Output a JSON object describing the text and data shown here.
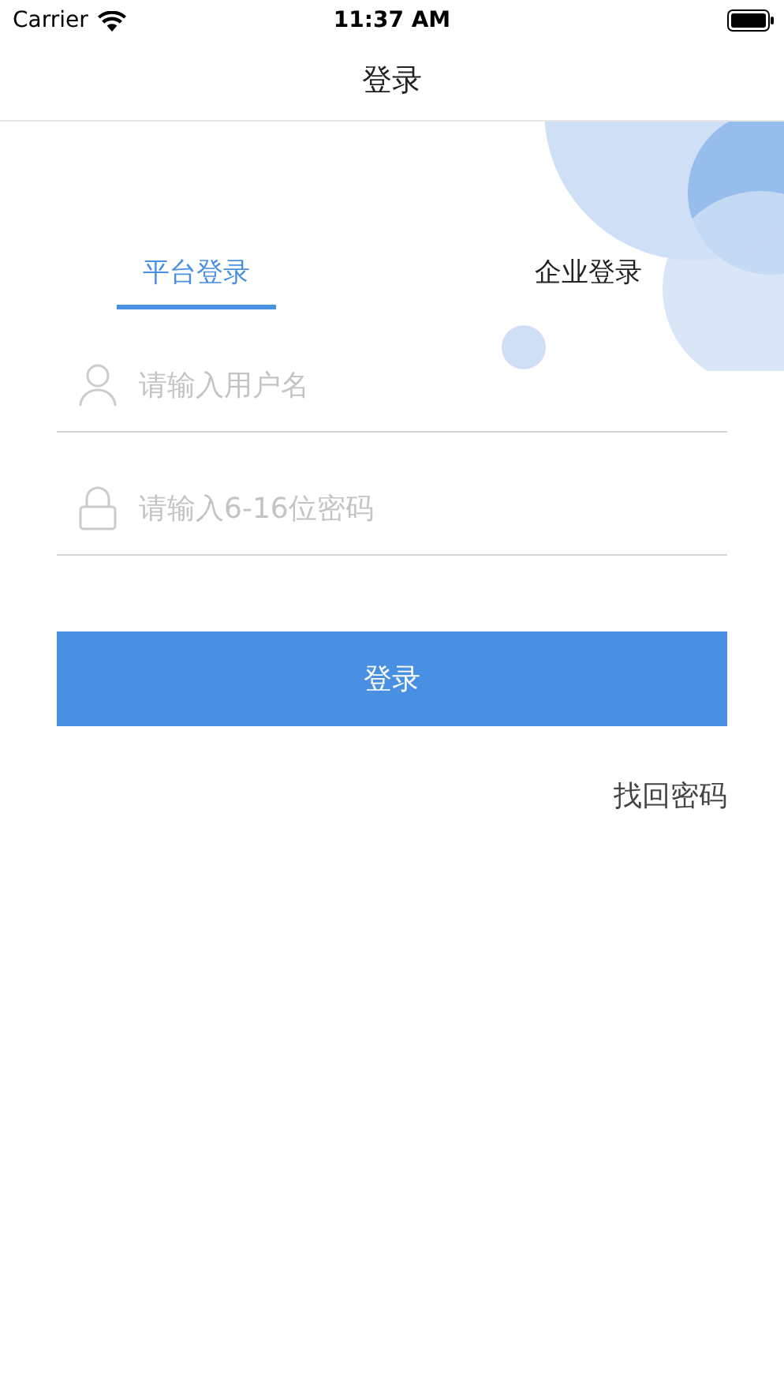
{
  "status_bar": {
    "carrier": "Carrier",
    "time": "11:37 AM"
  },
  "nav": {
    "title": "登录"
  },
  "tabs": [
    {
      "label": "平台登录",
      "selected": true
    },
    {
      "label": "企业登录",
      "selected": false
    }
  ],
  "fields": [
    {
      "kind": "user",
      "placeholder": "请输入用户名"
    },
    {
      "kind": "lock",
      "placeholder": "请输入6-16位密码"
    }
  ],
  "login_button": "登录",
  "forgot_link": "找回密码"
}
